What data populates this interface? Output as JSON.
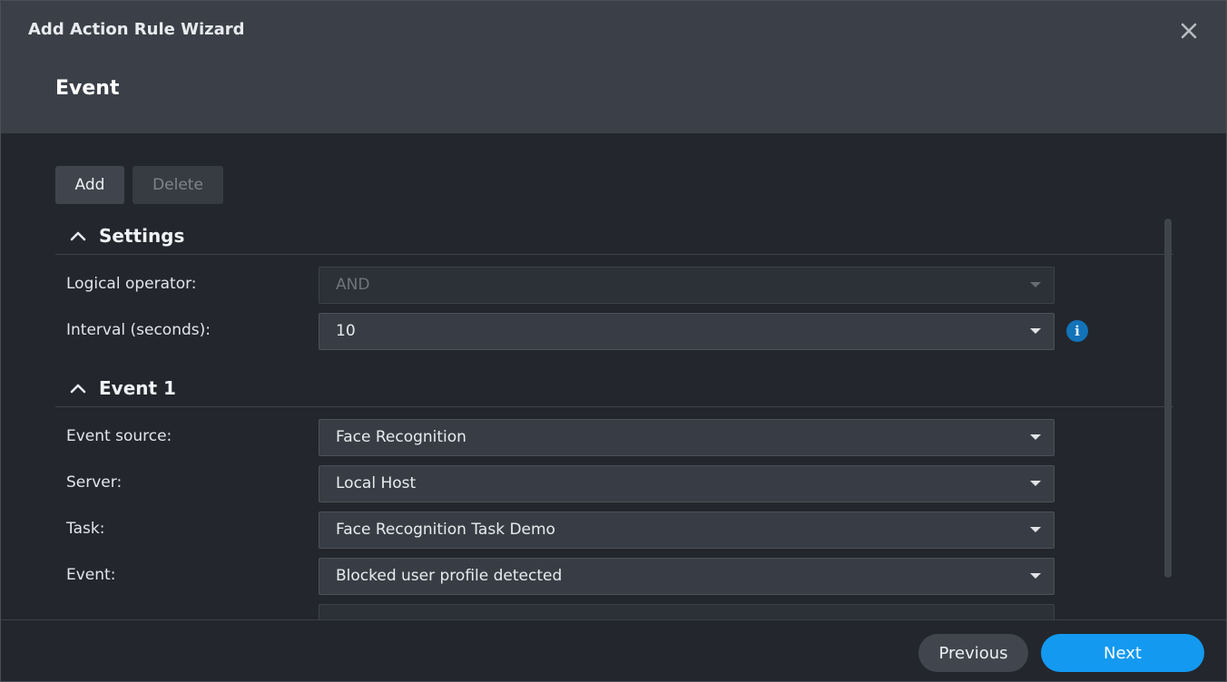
{
  "dialog": {
    "title": "Add Action Rule Wizard",
    "step_title": "Event"
  },
  "toolbar": {
    "add_label": "Add",
    "delete_label": "Delete"
  },
  "settings": {
    "title": "Settings",
    "logical_operator": {
      "label": "Logical operator:",
      "value": "AND"
    },
    "interval": {
      "label": "Interval (seconds):",
      "value": "10"
    }
  },
  "event1": {
    "title": "Event 1",
    "event_source": {
      "label": "Event source:",
      "value": "Face Recognition"
    },
    "server": {
      "label": "Server:",
      "value": "Local Host"
    },
    "task": {
      "label": "Task:",
      "value": "Face Recognition Task Demo"
    },
    "event": {
      "label": "Event:",
      "value": "Blocked user profile detected"
    }
  },
  "footer": {
    "previous_label": "Previous",
    "next_label": "Next"
  },
  "colors": {
    "accent": "#1399f0",
    "info": "#1273b8"
  }
}
